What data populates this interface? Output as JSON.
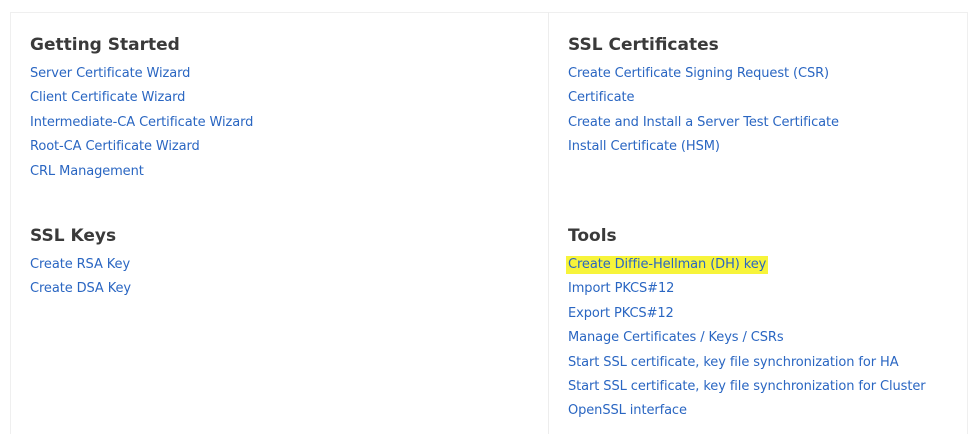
{
  "colors": {
    "link": "#2a66c2",
    "heading": "#3a3a3a",
    "highlight": "#f7f43a"
  },
  "getting_started": {
    "title": "Getting Started",
    "links": [
      "Server Certificate Wizard",
      "Client Certificate Wizard",
      "Intermediate-CA Certificate Wizard",
      "Root-CA Certificate Wizard",
      "CRL Management"
    ]
  },
  "ssl_certificates": {
    "title": "SSL Certificates",
    "links": [
      "Create Certificate Signing Request (CSR)",
      "Certificate",
      "Create and Install a Server Test Certificate",
      "Install Certificate (HSM)"
    ]
  },
  "ssl_keys": {
    "title": "SSL Keys",
    "links": [
      "Create RSA Key",
      "Create DSA Key"
    ]
  },
  "tools": {
    "title": "Tools",
    "links": [
      "Create Diffie-Hellman (DH) key",
      "Import PKCS#12",
      "Export PKCS#12",
      "Manage Certificates / Keys / CSRs",
      "Start SSL certificate, key file synchronization for HA",
      "Start SSL certificate, key file synchronization for Cluster",
      "OpenSSL interface"
    ],
    "highlighted_link": "Create Diffie-Hellman (DH) key"
  }
}
